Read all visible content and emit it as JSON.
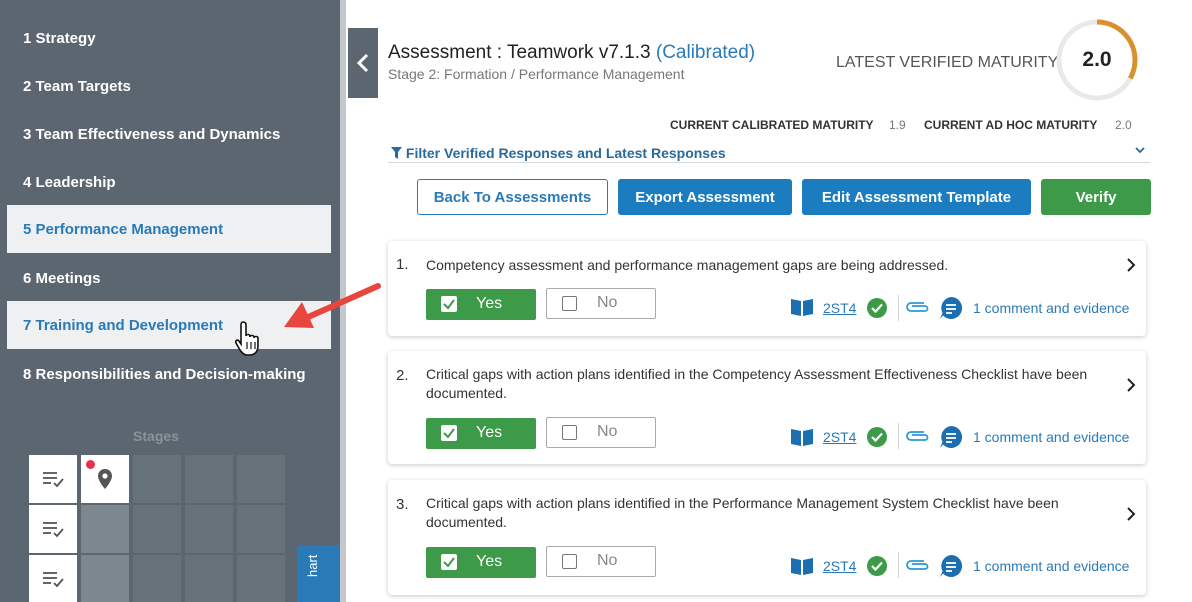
{
  "sidebar": {
    "items": [
      {
        "label": "1 Strategy"
      },
      {
        "label": "2 Team Targets"
      },
      {
        "label": "3 Team Effectiveness and Dynamics"
      },
      {
        "label": "4 Leadership"
      },
      {
        "label": "5 Performance Management"
      },
      {
        "label": "6 Meetings"
      },
      {
        "label": "7 Training and Development"
      },
      {
        "label": "8 Responsibilities and Decision-making"
      }
    ],
    "stages_label": "Stages",
    "chart_tab_label": "hart"
  },
  "header": {
    "title": "Assessment : Teamwork v7.1.3",
    "title_status": "(Calibrated)",
    "breadcrumb_stage": "Stage 2: Formation",
    "breadcrumb_sep": "/",
    "breadcrumb_section": "Performance Management",
    "latest_label": "LATEST VERIFIED MATURITY",
    "latest_value": "2.0",
    "latest_fraction": 0.33,
    "calibrated_label": "CURRENT CALIBRATED MATURITY",
    "calibrated_value": "1.9",
    "adhoc_label": "CURRENT AD HOC MATURITY",
    "adhoc_value": "2.0"
  },
  "filter": {
    "label": "Filter Verified Responses and Latest Responses"
  },
  "buttons": {
    "back": "Back To Assessments",
    "export": "Export Assessment",
    "edit": "Edit Assessment Template",
    "verify": "Verify"
  },
  "questions": [
    {
      "num": "1.",
      "text": "Competency assessment and performance management gaps are being addressed.",
      "yes": "Yes",
      "no": "No",
      "code": "2ST4",
      "evidence": "1 comment and evidence"
    },
    {
      "num": "2.",
      "text": "Critical gaps with action plans identified in the Competency Assessment Effectiveness Checklist have been documented.",
      "yes": "Yes",
      "no": "No",
      "code": "2ST4",
      "evidence": "1 comment and evidence"
    },
    {
      "num": "3.",
      "text": "Critical gaps with action plans identified in the Performance Management System Checklist have been documented.",
      "yes": "Yes",
      "no": "No",
      "code": "2ST4",
      "evidence": "1 comment and evidence"
    }
  ],
  "colors": {
    "accent": "#2a7ab8",
    "green": "#3d9a48",
    "sidebar": "#5c6670",
    "ring": "#d9912f",
    "annotation": "#e8453c"
  }
}
